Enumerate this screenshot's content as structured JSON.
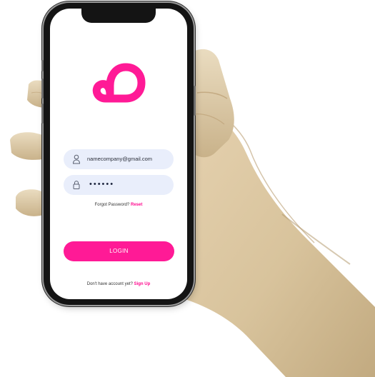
{
  "login": {
    "email_value": "namecompany@gmail.com",
    "password_masked": "••••••",
    "forgot_text": "Forgot Password?",
    "reset_label": "Reset",
    "login_label": "LOGIN",
    "signup_text": "Don't have account yet?",
    "signup_label": "Sign Up"
  },
  "colors": {
    "accent": "#ff1a96",
    "field_bg": "#e9eefb"
  },
  "icons": {
    "user": "user-icon",
    "lock": "lock-icon",
    "logo": "app-logo"
  }
}
